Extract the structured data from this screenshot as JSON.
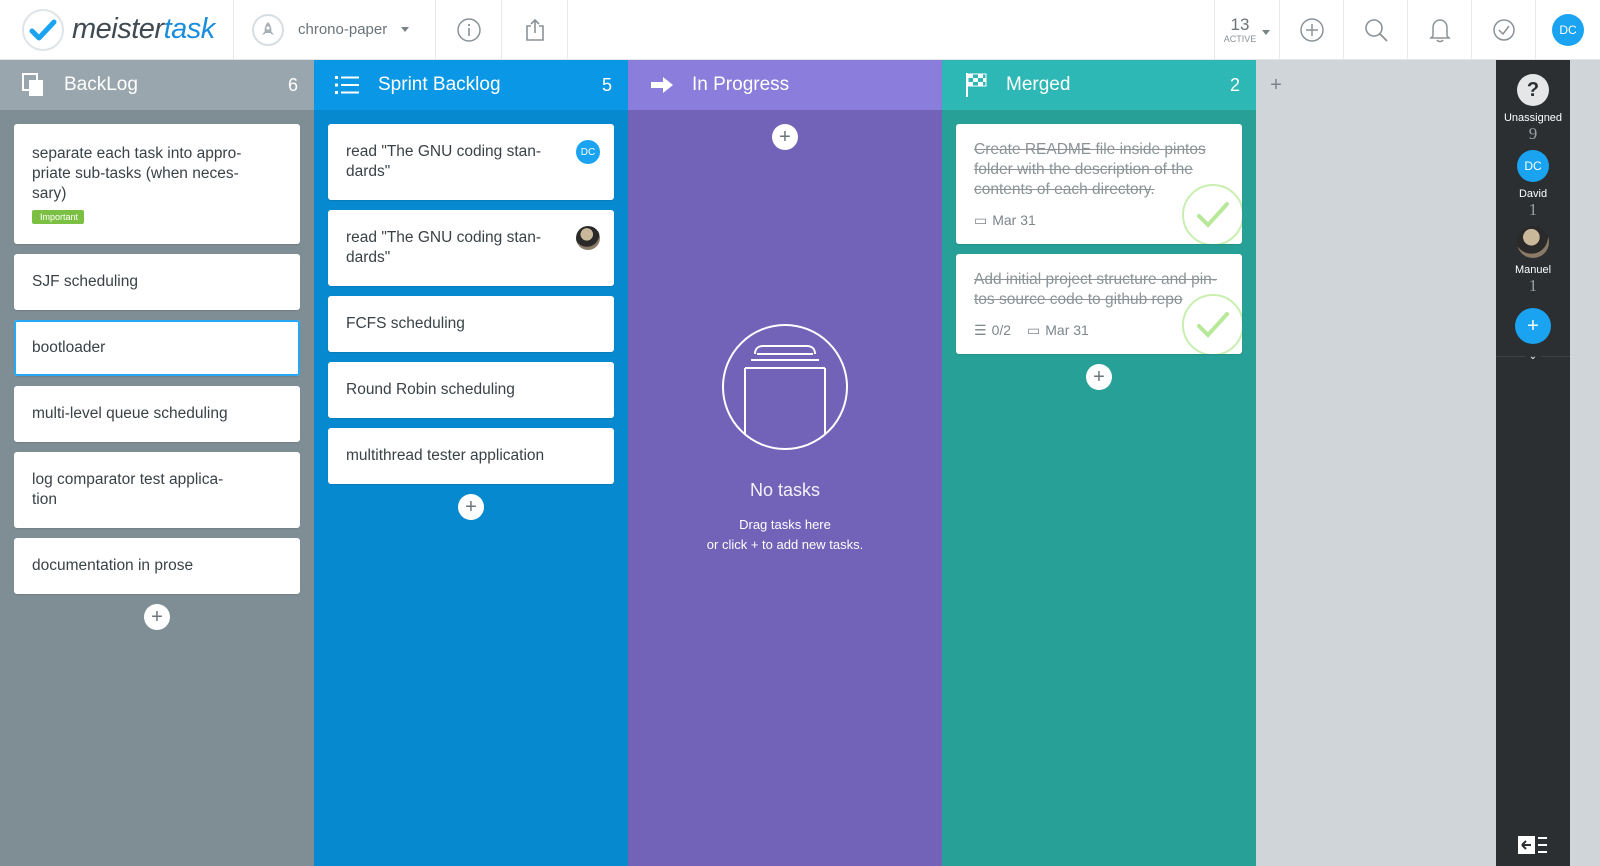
{
  "app": {
    "logo_a": "meister",
    "logo_b": "task"
  },
  "topbar": {
    "project_name": "chrono-paper",
    "active_count": "13",
    "active_label": "ACTIVE",
    "user_initials": "DC"
  },
  "columns": {
    "backlog": {
      "title": "BackLog",
      "count": "6",
      "cards": [
        {
          "text": "separate each task into appro-\npriate sub-tasks (when neces-\nsary)",
          "tag": "Important"
        },
        {
          "text": "SJF scheduling"
        },
        {
          "text": "bootloader"
        },
        {
          "text": "multi-level queue scheduling"
        },
        {
          "text": "log comparator test applica-\ntion"
        },
        {
          "text": "documentation in prose"
        }
      ]
    },
    "sprint": {
      "title": "Sprint Backlog",
      "count": "5",
      "cards": [
        {
          "text": "read \"The GNU coding stan-\ndards\"",
          "assignee": "DC"
        },
        {
          "text": "read \"The GNU coding stan-\ndards\""
        },
        {
          "text": "FCFS scheduling"
        },
        {
          "text": "Round Robin scheduling"
        },
        {
          "text": "multithread tester application"
        }
      ]
    },
    "progress": {
      "title": "In Progress",
      "empty_title": "No tasks",
      "empty_line1": "Drag tasks here",
      "empty_line2": "or click + to add new tasks."
    },
    "merged": {
      "title": "Merged",
      "count": "2",
      "cards": [
        {
          "text": "Create README file inside pintos\nfolder with the description of the\ncontents of each directory.",
          "date": "Mar 31"
        },
        {
          "text": "Add initial project structure and pin-\ntos source code to github repo",
          "checklist": "0/2",
          "date": "Mar 31"
        }
      ]
    }
  },
  "sidebar": {
    "unassigned_label": "Unassigned",
    "unassigned_count": "9",
    "user1_initials": "DC",
    "user1_name": "David",
    "user1_count": "1",
    "user2_name": "Manuel",
    "user2_count": "1"
  },
  "colors": {
    "backlog": "#99a6ad",
    "sprint": "#0a97e6",
    "progress": "#7b6cc8",
    "merged": "#2db7b5",
    "accent": "#1aa3f0"
  }
}
